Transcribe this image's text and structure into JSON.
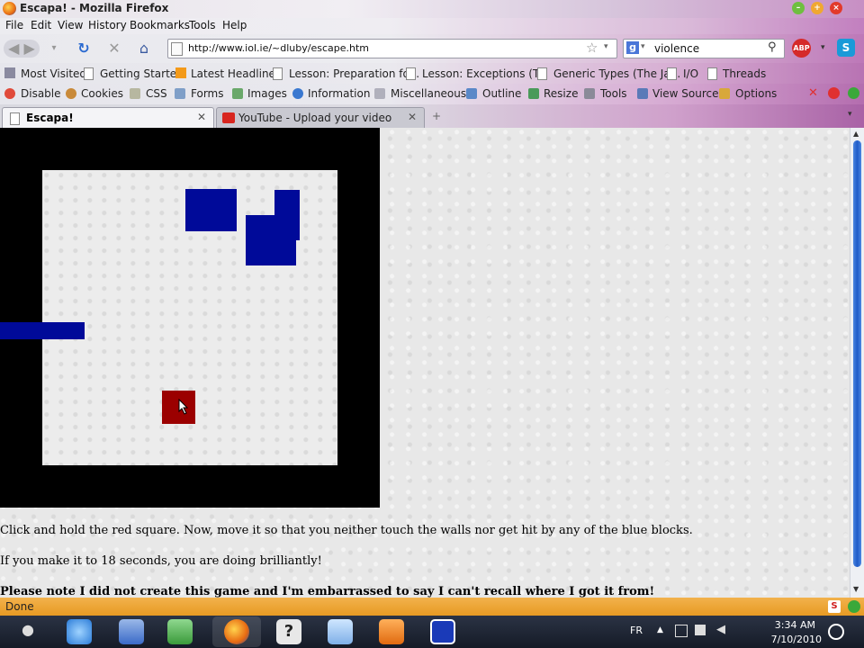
{
  "window": {
    "title": "Escapa! - Mozilla Firefox"
  },
  "menu": {
    "items": [
      "File",
      "Edit",
      "View",
      "History",
      "Bookmarks",
      "Tools",
      "Help"
    ]
  },
  "nav": {
    "url": "http://www.iol.ie/~dluby/escape.htm",
    "search_query": "violence",
    "adblock_label": "ABP"
  },
  "bookmarks": {
    "items": [
      "Most Visited",
      "Getting Started",
      "Latest Headlines",
      "Lesson: Preparation fo...",
      "Lesson: Exceptions (T...",
      "Generic Types (The Ja...",
      "I/O",
      "Threads"
    ]
  },
  "devbar": {
    "items": [
      "Disable",
      "Cookies",
      "CSS",
      "Forms",
      "Images",
      "Information",
      "Miscellaneous",
      "Outline",
      "Resize",
      "Tools",
      "View Source",
      "Options"
    ]
  },
  "tabs": [
    {
      "label": "Escapa!",
      "active": true
    },
    {
      "label": "YouTube - Upload your video",
      "active": false
    }
  ],
  "page": {
    "instructions": "Click and hold the red square. Now, move it so that you neither touch the walls nor get hit by any of the blue blocks.",
    "goal": "If you make it to 18 seconds, you are doing brilliantly!",
    "note": "Please note I did not create this game and I'm embarrassed to say I can't recall where I got it from!"
  },
  "status": {
    "text": "Done"
  },
  "taskbar": {
    "lang": "FR",
    "time": "3:34 AM",
    "date": "7/10/2010"
  },
  "colors": {
    "player": "#9b0000",
    "enemy": "#000a99",
    "wall": "#000000",
    "status_bar": "#e79a23"
  }
}
